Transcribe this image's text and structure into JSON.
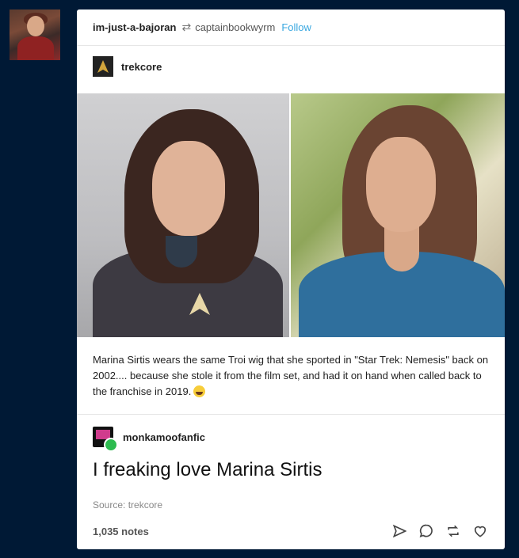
{
  "header": {
    "username": "im-just-a-bajoran",
    "reblogged_from": "captainbookwyrm",
    "follow_label": "Follow"
  },
  "source_post": {
    "blog_name": "trekcore",
    "caption": "Marina Sirtis wears the same Troi wig that she sported in \"Star Trek: Nemesis\" back on 2002.... because she stole it from the film set, and had it on hand when called back to the franchise in 2019."
  },
  "reply": {
    "blog_name": "monkamoofanfic",
    "text": "I freaking love Marina Sirtis"
  },
  "source_label": "Source: trekcore",
  "footer": {
    "notes": "1,035 notes"
  },
  "icons": [
    "reblog-icon",
    "share-icon",
    "reply-icon",
    "reblog-button-icon",
    "like-icon"
  ],
  "colors": {
    "background": "#001935",
    "follow": "#3aa8e0",
    "card": "#ffffff"
  }
}
